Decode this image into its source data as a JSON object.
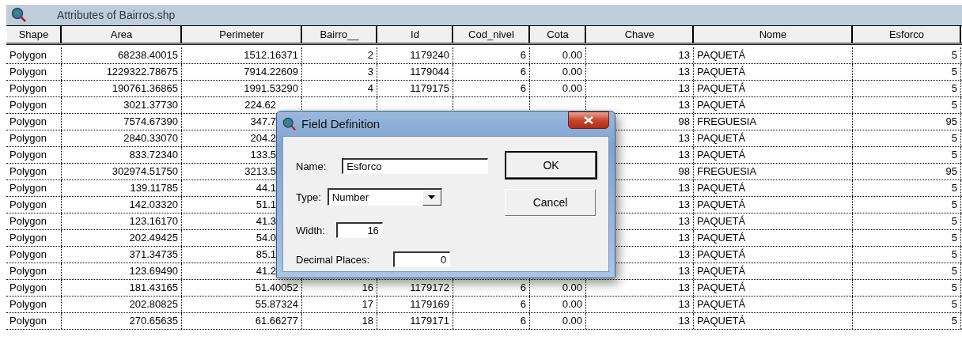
{
  "window": {
    "title": "Attributes of Bairros.shp"
  },
  "table": {
    "columns": [
      {
        "label": "Shape",
        "kind": "text"
      },
      {
        "label": "Area",
        "kind": "number"
      },
      {
        "label": "Perimeter",
        "kind": "number"
      },
      {
        "label": "Bairro__",
        "kind": "number"
      },
      {
        "label": "Id",
        "kind": "number"
      },
      {
        "label": "Cod_nivel",
        "kind": "number"
      },
      {
        "label": "Cota",
        "kind": "number"
      },
      {
        "label": "Chave",
        "kind": "number"
      },
      {
        "label": "Nome",
        "kind": "text"
      },
      {
        "label": "Esforco",
        "kind": "number"
      }
    ],
    "rows": [
      [
        "Polygon",
        "68238.40015",
        "1512.16371",
        "2",
        "1179240",
        "6",
        "0.00",
        "13",
        "PAQUETÁ",
        "5"
      ],
      [
        "Polygon",
        "1229322.78675",
        "7914.22609",
        "3",
        "1179044",
        "6",
        "0.00",
        "13",
        "PAQUETÁ",
        "5"
      ],
      [
        "Polygon",
        "190761.36865",
        "1991.53290",
        "4",
        "1179175",
        "6",
        "0.00",
        "13",
        "PAQUETÁ",
        "5"
      ],
      [
        "Polygon",
        "3021.37730",
        "224.62",
        null,
        null,
        null,
        null,
        "13",
        "PAQUETÁ",
        "5"
      ],
      [
        "Polygon",
        "7574.67390",
        "347.7",
        null,
        null,
        null,
        null,
        "98",
        "FREGUESIA",
        "95"
      ],
      [
        "Polygon",
        "2840.33070",
        "204.2",
        null,
        null,
        null,
        null,
        "13",
        "PAQUETÁ",
        "5"
      ],
      [
        "Polygon",
        "833.72340",
        "133.5",
        null,
        null,
        null,
        null,
        "13",
        "PAQUETÁ",
        "5"
      ],
      [
        "Polygon",
        "302974.51750",
        "3213.5",
        null,
        null,
        null,
        null,
        "98",
        "FREGUESIA",
        "95"
      ],
      [
        "Polygon",
        "139.11785",
        "44.1",
        null,
        null,
        null,
        null,
        "13",
        "PAQUETÁ",
        "5"
      ],
      [
        "Polygon",
        "142.03320",
        "51.1",
        null,
        null,
        null,
        null,
        "13",
        "PAQUETÁ",
        "5"
      ],
      [
        "Polygon",
        "123.16170",
        "41.3",
        null,
        null,
        null,
        null,
        "13",
        "PAQUETÁ",
        "5"
      ],
      [
        "Polygon",
        "202.49425",
        "54.0",
        null,
        null,
        null,
        null,
        "13",
        "PAQUETÁ",
        "5"
      ],
      [
        "Polygon",
        "371.34735",
        "85.1",
        null,
        null,
        null,
        null,
        "13",
        "PAQUETÁ",
        "5"
      ],
      [
        "Polygon",
        "123.69490",
        "41.2",
        null,
        null,
        null,
        null,
        "13",
        "PAQUETÁ",
        "5"
      ],
      [
        "Polygon",
        "181.43165",
        "51.40052",
        "16",
        "1179172",
        "6",
        "0.00",
        "13",
        "PAQUETÁ",
        "5"
      ],
      [
        "Polygon",
        "202.80825",
        "55.87324",
        "17",
        "1179169",
        "6",
        "0.00",
        "13",
        "PAQUETÁ",
        "5"
      ],
      [
        "Polygon",
        "270.65635",
        "61.66277",
        "18",
        "1179171",
        "6",
        "0.00",
        "13",
        "PAQUETÁ",
        "5"
      ]
    ]
  },
  "dialog": {
    "title": "Field Definition",
    "fields": [
      {
        "kind": "text",
        "label": "Name:",
        "value": "Esforco"
      },
      {
        "kind": "select",
        "label": "Type:",
        "value": "Number"
      },
      {
        "kind": "number",
        "label": "Width:",
        "value": "16"
      },
      {
        "kind": "number",
        "label": "Decimal Places:",
        "value": "0"
      }
    ],
    "buttons": [
      {
        "label": "OK",
        "default": true
      },
      {
        "label": "Cancel",
        "default": false
      }
    ]
  }
}
